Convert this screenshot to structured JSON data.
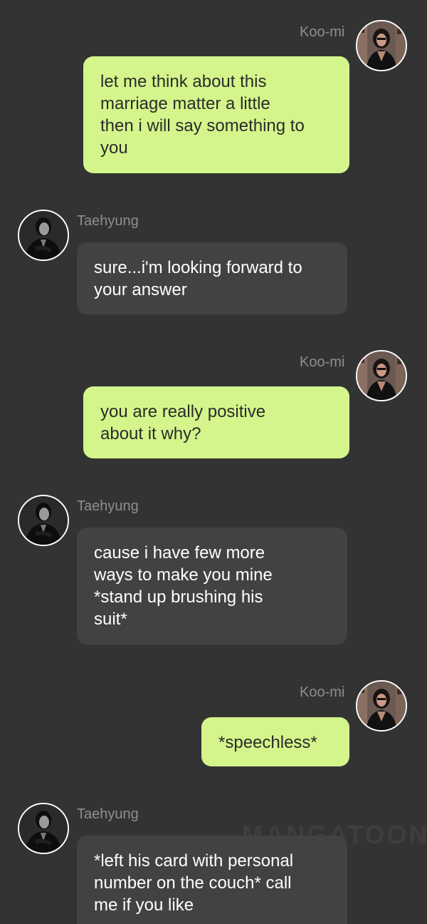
{
  "colors": {
    "background": "#333333",
    "my_bubble": "#d3f58b",
    "their_bubble": "#424242",
    "name_text": "#8e8e8e"
  },
  "messages": [
    {
      "sender": "Koo-mi",
      "side": "right",
      "avatar": "woman-avatar",
      "text": "let me think about this\nmarriage matter a little\nthen i will say something to\nyou"
    },
    {
      "sender": "Taehyung",
      "side": "left",
      "avatar": "man-avatar",
      "text": "sure...i'm looking forward to\nyour answer"
    },
    {
      "sender": "Koo-mi",
      "side": "right",
      "avatar": "woman-avatar",
      "text": "you are really positive\nabout it why?"
    },
    {
      "sender": "Taehyung",
      "side": "left",
      "avatar": "man-avatar",
      "text": "cause i have few more\nways to make you mine\n*stand up brushing his\nsuit*"
    },
    {
      "sender": "Koo-mi",
      "side": "right",
      "avatar": "woman-avatar",
      "text": "*speechless*"
    },
    {
      "sender": "Taehyung",
      "side": "left",
      "avatar": "man-avatar",
      "text": "*left his card with personal\nnumber on the couch* call\nme if you like"
    }
  ],
  "watermark": "MANGATOON"
}
